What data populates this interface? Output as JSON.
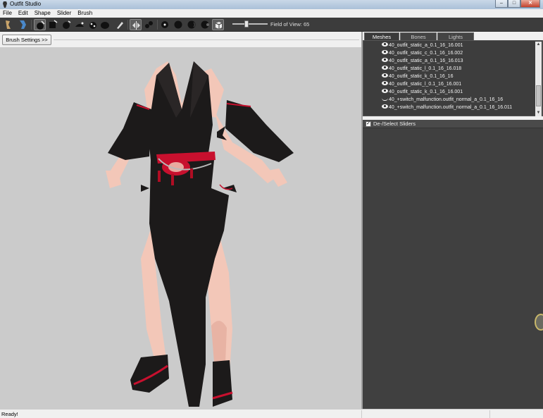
{
  "window": {
    "title": "Outfit Studio",
    "min_label": "–",
    "max_label": "□",
    "close_label": "✕"
  },
  "menu": [
    "File",
    "Edit",
    "Shape",
    "Slider",
    "Brush"
  ],
  "toolbar": {
    "buttons": [
      "select-tool",
      "transform-tool",
      "inflate-brush",
      "deflate-brush",
      "move-brush",
      "smooth-brush",
      "mask-brush",
      "weight-brush",
      "color-brush",
      "undo-brush",
      "mirror-toggle",
      "connected-toggle",
      "vertex-view",
      "wireframe-view",
      "light-view",
      "texture-view",
      "front-view"
    ],
    "fov_label": "Field of View: 65",
    "fov_value": 65
  },
  "brush_settings_label": "Brush Settings >>",
  "tabs": [
    "Meshes",
    "Bones",
    "Lights"
  ],
  "meshes": [
    {
      "name": "40_outfit_static_a_0.1_16_16.001",
      "visible": true
    },
    {
      "name": "40_outfit_static_c_0.1_16_16.002",
      "visible": true
    },
    {
      "name": "40_outfit_static_a_0.1_16_16.013",
      "visible": true
    },
    {
      "name": "40_outfit_static_l_0.1_16_16.018",
      "visible": true
    },
    {
      "name": "40_outfit_static_k_0.1_16_16",
      "visible": true
    },
    {
      "name": "40_outfit_static_l_0.1_16_16.001",
      "visible": true
    },
    {
      "name": "40_outfit_static_k_0.1_16_16.001",
      "visible": true
    },
    {
      "name": "40_+switch_malfunction.outfit_normal_a_0.1_16_16",
      "visible": false
    },
    {
      "name": "40_+switch_malfunction.outfit_normal_a_0.1_16_16.011",
      "visible": true
    }
  ],
  "sliders": {
    "deselect_label": "De-/Select Sliders",
    "checked": true,
    "check_mark": "✓"
  },
  "status": {
    "text": "Ready!"
  },
  "colors": {
    "toolbar_bg": "#3c3c3c",
    "viewport_bg": "#cbcbcb",
    "panel_bg": "#3a3a3a",
    "outfit_black": "#1c1a1a",
    "accent_red": "#c8102e",
    "skin": "#f3c7b8"
  }
}
